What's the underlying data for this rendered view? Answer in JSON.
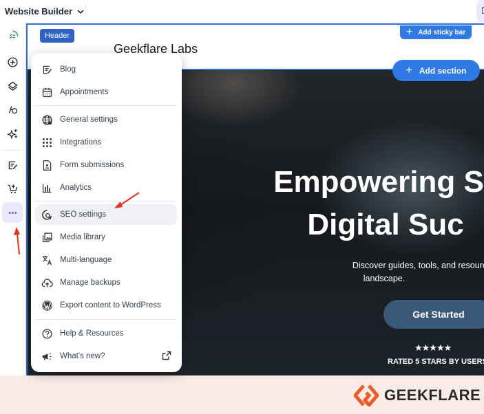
{
  "topbar": {
    "app_title": "Website Builder"
  },
  "sidebar": {
    "items": [
      {
        "name": "progress-checklist",
        "icon": "checklist-progress-icon"
      },
      {
        "name": "add-element",
        "icon": "plus-circle-icon"
      },
      {
        "name": "layers",
        "icon": "layers-icon"
      },
      {
        "name": "site-styles",
        "icon": "palette-icon"
      },
      {
        "name": "ai-tools",
        "icon": "sparkle-icon"
      },
      {
        "name": "blog",
        "icon": "blog-edit-icon"
      },
      {
        "name": "store",
        "icon": "cart-add-icon"
      },
      {
        "name": "more",
        "icon": "more-dots-icon",
        "active": true
      }
    ]
  },
  "canvas": {
    "header_tag": "Header",
    "site_logo_text": "Geekflare Labs",
    "add_sticky_bar": "Add sticky bar",
    "add_section": "Add section",
    "hero": {
      "title_line1": "Empowering S",
      "title_line2": "Digital Suc",
      "subtitle_line1": "Discover guides, tools, and resources to th",
      "subtitle_line2": "landscape.",
      "cta": "Get Started",
      "stars": "★★★★★",
      "rating_text": "RATED 5 STARS BY USERS"
    }
  },
  "menu": {
    "groups": [
      [
        {
          "label": "Blog",
          "icon": "blog-edit-icon"
        },
        {
          "label": "Appointments",
          "icon": "calendar-icon"
        }
      ],
      [
        {
          "label": "General settings",
          "icon": "globe-settings-icon"
        },
        {
          "label": "Integrations",
          "icon": "grid-dots-icon"
        },
        {
          "label": "Form submissions",
          "icon": "form-icon"
        },
        {
          "label": "Analytics",
          "icon": "bar-chart-icon"
        }
      ],
      [
        {
          "label": "SEO settings",
          "icon": "seo-search-icon",
          "hovered": true
        },
        {
          "label": "Media library",
          "icon": "media-library-icon"
        },
        {
          "label": "Multi-language",
          "icon": "translate-icon"
        },
        {
          "label": "Manage backups",
          "icon": "cloud-upload-icon"
        },
        {
          "label": "Export content to WordPress",
          "icon": "wordpress-icon"
        }
      ],
      [
        {
          "label": "Help & Resources",
          "icon": "help-circle-icon"
        },
        {
          "label": "What's new?",
          "icon": "megaphone-icon",
          "external": true
        }
      ]
    ]
  },
  "footer": {
    "brand": "GEEKFLARE",
    "brand_color": "#f05a22"
  },
  "colors": {
    "accent_blue": "#2f7ae5",
    "selection_border": "#2f6fd8",
    "active_sidebar_bg": "#ebe8fd",
    "annotation_arrow": "#e8321e"
  }
}
